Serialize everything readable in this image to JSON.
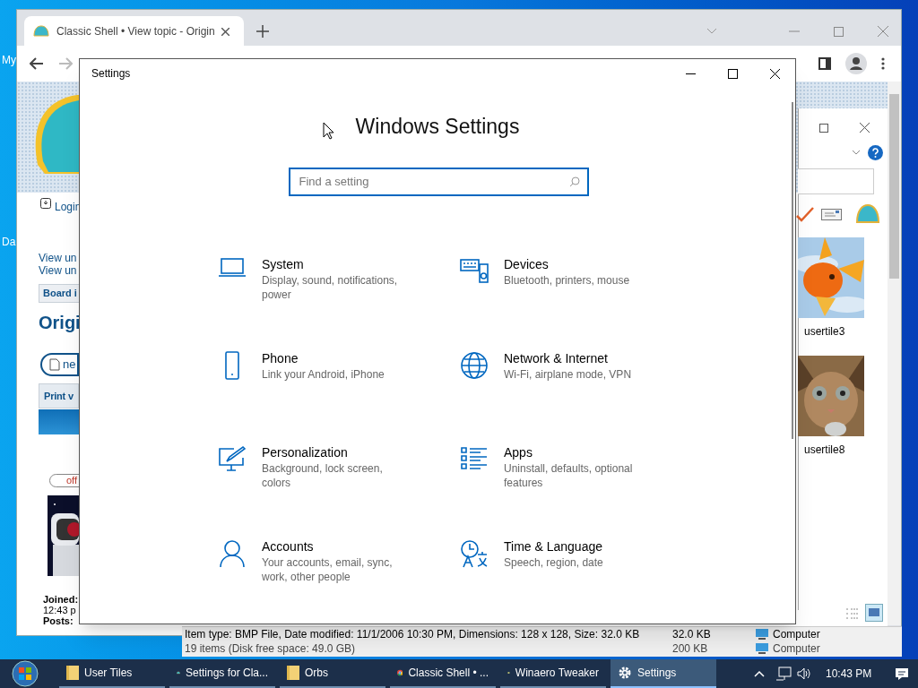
{
  "desktop_icons": [
    {
      "label": "My"
    },
    {
      "label": "Da"
    }
  ],
  "browser": {
    "tab": {
      "title": "Classic Shell • View topic - Origin",
      "selected": true
    },
    "page_left": {
      "login": "Login",
      "links": [
        "View un",
        "View un"
      ],
      "breadcrumb": "Board i",
      "topic_title": "Origi",
      "new_button": "ne",
      "print_link": "Print v",
      "status_badge": "off",
      "joined_label": "Joined:",
      "joined_time": "12:43 p",
      "posts_label": "Posts:"
    },
    "explorer": {
      "thumbnails": [
        {
          "label": "usertile3",
          "kind": "fish"
        },
        {
          "label": "usertile8",
          "kind": "cat"
        }
      ],
      "status": {
        "details": "Item type: BMP File, Date modified: 11/1/2006 10:30 PM, Dimensions: 128 x 128, Size: 32.0 KB",
        "size": "32.0 KB",
        "location": "Computer",
        "summary": "19 items (Disk free space: 49.0 GB)",
        "summary_size": "200 KB",
        "summary_location": "Computer"
      }
    }
  },
  "settings": {
    "title": "Settings",
    "heading": "Windows Settings",
    "search": {
      "placeholder": "Find a setting"
    },
    "categories": [
      {
        "title": "System",
        "description": "Display, sound, notifications, power"
      },
      {
        "title": "Devices",
        "description": "Bluetooth, printers, mouse"
      },
      {
        "title": "Phone",
        "description": "Link your Android, iPhone"
      },
      {
        "title": "Network & Internet",
        "description": "Wi-Fi, airplane mode, VPN"
      },
      {
        "title": "Personalization",
        "description": "Background, lock screen, colors"
      },
      {
        "title": "Apps",
        "description": "Uninstall, defaults, optional features"
      },
      {
        "title": "Accounts",
        "description": "Your accounts, email, sync, work, other people"
      },
      {
        "title": "Time & Language",
        "description": "Speech, region, date"
      }
    ]
  },
  "taskbar": {
    "items": [
      {
        "label": "User Tiles",
        "selected": false
      },
      {
        "label": "Settings for Cla...",
        "selected": false
      },
      {
        "label": "Orbs",
        "selected": false
      },
      {
        "label": "Classic Shell • ...",
        "selected": false
      },
      {
        "label": "Winaero Tweaker",
        "selected": false
      },
      {
        "label": "Settings",
        "selected": true
      }
    ],
    "time": "10:43 PM"
  }
}
